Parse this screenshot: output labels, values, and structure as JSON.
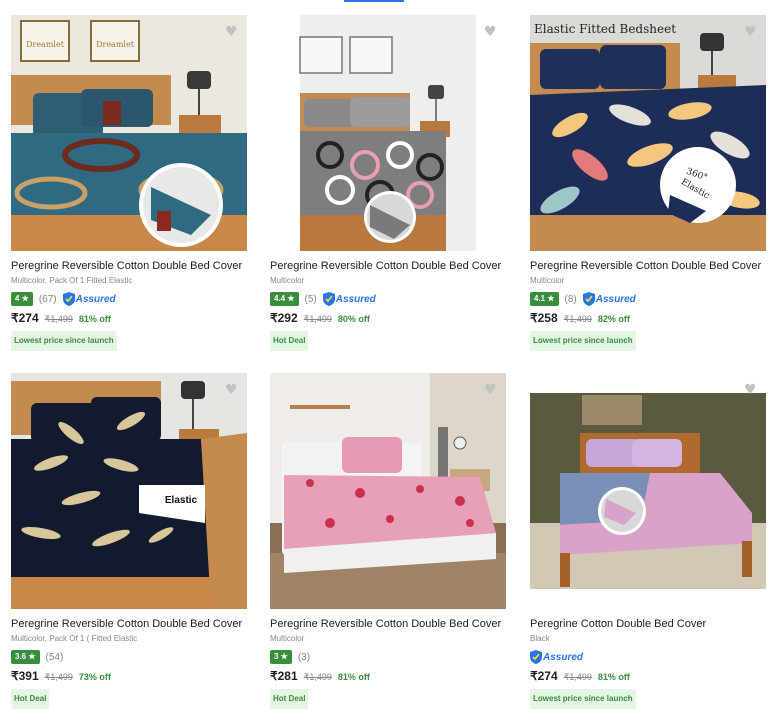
{
  "icons": {
    "wishlist": "heart-icon",
    "rating_star": "star-icon",
    "assured": "shield-icon"
  },
  "colors": {
    "rating_green": "#388e3c",
    "assured_blue": "#2874f0",
    "deal_bg": "#e6f6e4",
    "accent": "#2874f0"
  },
  "products": [
    {
      "title": "Peregrine Reversible Cotton Double Bed Cover",
      "subtitle": "Multicolor, Pack Of 1 Fitted Elastic",
      "rating": "4 ★",
      "reviews": "(67)",
      "assured": "Assured",
      "price": "₹274",
      "mrp": "₹1,499",
      "discount": "81% off",
      "deal": "Lowest price since launch",
      "image_text": [
        "Dreamlet",
        "Dreamlet"
      ]
    },
    {
      "title": "Peregrine Reversible Cotton Double Bed Cover",
      "subtitle": "Multicolor",
      "rating": "4.4 ★",
      "reviews": "(5)",
      "assured": "Assured",
      "price": "₹292",
      "mrp": "₹1,499",
      "discount": "80% off",
      "deal": "Hot Deal",
      "image_text": []
    },
    {
      "title": "Peregrine Reversible Cotton Double Bed Cover",
      "subtitle": "Multicolor",
      "rating": "4.1 ★",
      "reviews": "(8)",
      "assured": "Assured",
      "price": "₹258",
      "mrp": "₹1,499",
      "discount": "82% off",
      "deal": "Lowest price since launch",
      "image_text": [
        "Elastic Fitted Bedsheet",
        "360°",
        "Elastic"
      ]
    },
    {
      "title": "Peregrine Reversible Cotton Double Bed Cover",
      "subtitle": "Multicolor, Pack Of 1 ( Fitted Elastic",
      "rating": "3.6 ★",
      "reviews": "(54)",
      "assured": "",
      "price": "₹391",
      "mrp": "₹1,499",
      "discount": "73% off",
      "deal": "Hot Deal",
      "image_text": [
        "Elastic"
      ]
    },
    {
      "title": "Peregrine Reversible Cotton Double Bed Cover",
      "subtitle": "Multicolor",
      "rating": "3 ★",
      "reviews": "(3)",
      "assured": "",
      "price": "₹281",
      "mrp": "₹1,499",
      "discount": "81% off",
      "deal": "Hot Deal",
      "image_text": []
    },
    {
      "title": "Peregrine Cotton Double Bed Cover",
      "subtitle": "Black",
      "rating": "",
      "reviews": "",
      "assured": "Assured",
      "price": "₹274",
      "mrp": "₹1,499",
      "discount": "81% off",
      "deal": "Lowest price since launch",
      "image_text": []
    }
  ]
}
